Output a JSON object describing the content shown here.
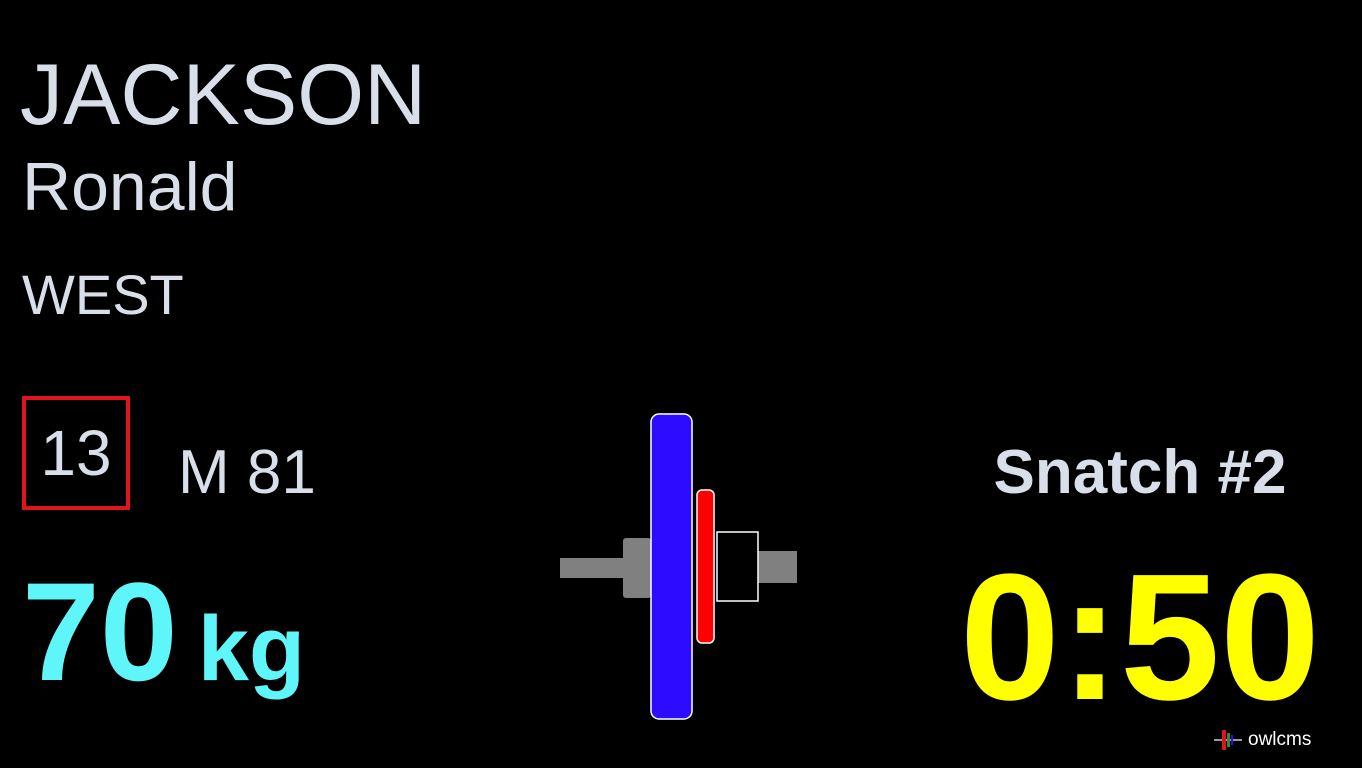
{
  "athlete": {
    "last_name": "JACKSON",
    "first_name": "Ronald",
    "team": "WEST",
    "start_number": "13",
    "category": "M 81"
  },
  "lift": {
    "weight": "70",
    "unit": "kg",
    "attempt": "Snatch #2"
  },
  "timer": {
    "display": "0:50"
  },
  "plates": [
    {
      "color": "#2c0bff",
      "label": "blue-plate"
    },
    {
      "color": "#ff0000",
      "label": "red-plate"
    },
    {
      "color": "#000000",
      "label": "white-outline-plate"
    }
  ],
  "colors": {
    "text": "#d9dfe8",
    "weight": "#5ff6fa",
    "timer": "#ffff00",
    "start_box_border": "#e0141c",
    "sleeve": "#808080"
  },
  "brand": {
    "name": "owlcms",
    "icon": "owlcms-logo-icon"
  }
}
